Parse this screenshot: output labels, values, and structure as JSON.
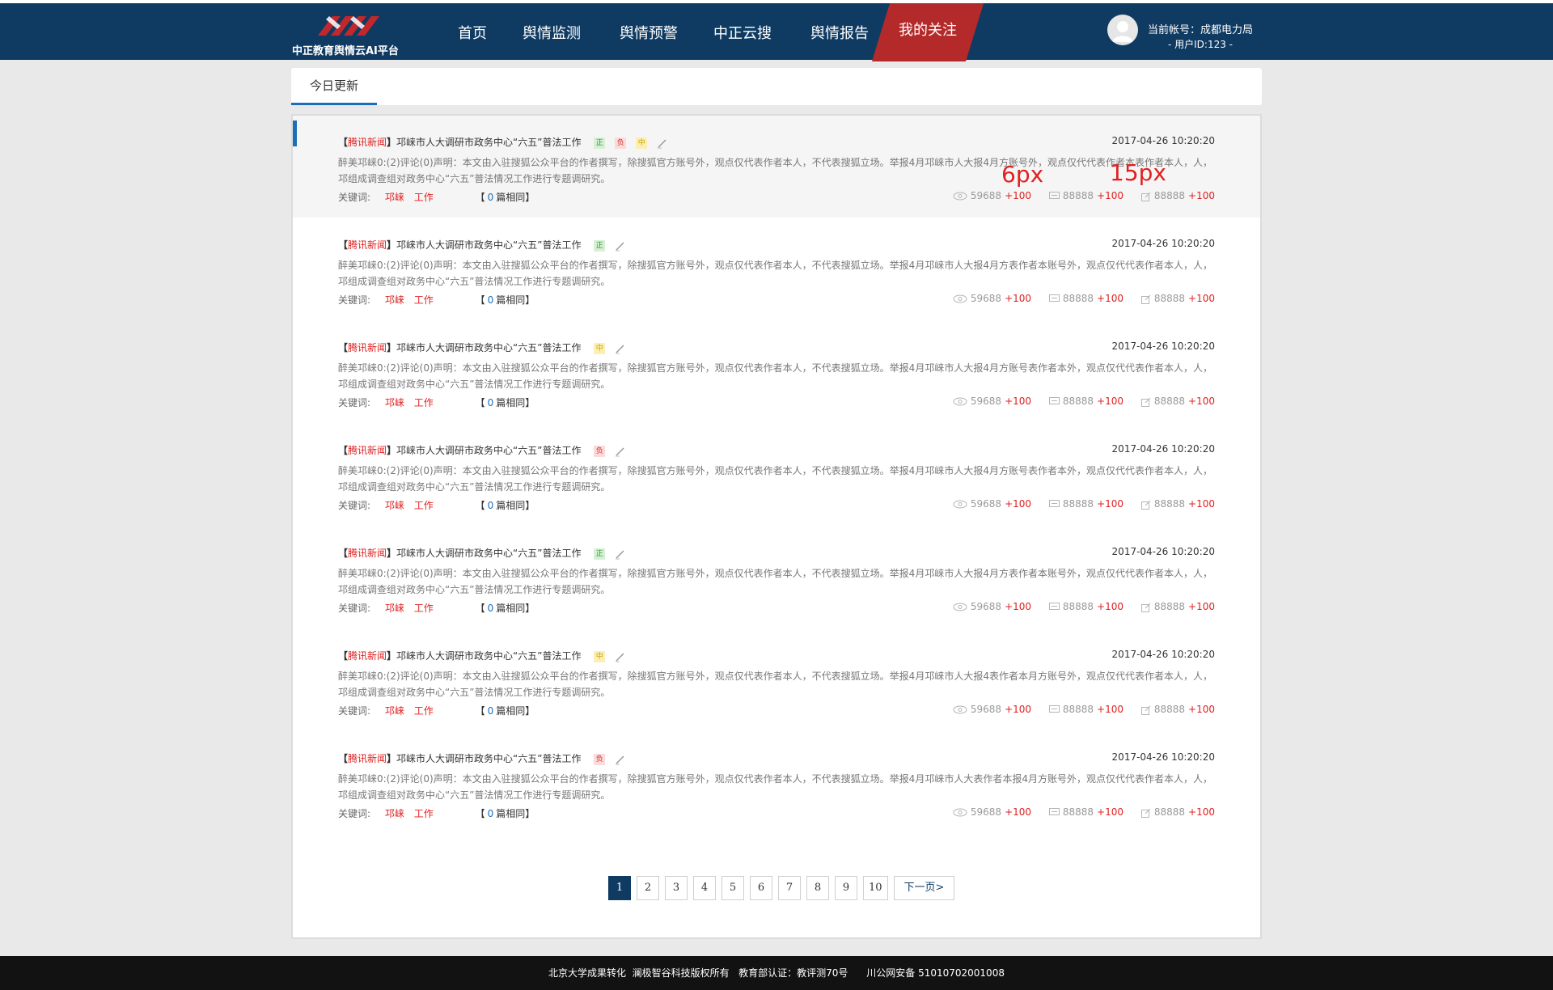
{
  "header": {
    "logo_text": "中正教育舆情云AI平台",
    "nav": [
      "首页",
      "舆情监测",
      "舆情预警",
      "中正云搜",
      "舆情报告"
    ],
    "nav_active": "我的关注",
    "account_label": "当前帐号：成都电力局",
    "user_id": "- 用户ID:123 -"
  },
  "tabs": {
    "active": "今日更新"
  },
  "annotations": {
    "gap_6": "6px",
    "gap_15": "15px"
  },
  "items": [
    {
      "source": "腾讯新闻",
      "title": "邛崃市人大调研市政务中心“六五”普法工作",
      "tags": [
        "正",
        "负",
        "中"
      ],
      "time": "2017-04-26 10:20:20",
      "desc": "醉美邛崃0:(2)评论(0)声明：本文由入驻搜狐公众平台的作者撰写，除搜狐官方账号外，观点仅代表作者本人，不代表搜狐立场。举报4月邛崃市人大报4月方账号外，观点仅代代表作者本表作者本人，人，邛组成调查组对政务中心“六五”普法情况工作进行专题调研究。",
      "kw_label": "关键词:",
      "keywords": [
        "邛崃",
        "工作"
      ],
      "similar_pre": "【",
      "similar_num": "0",
      "similar_post": "篇相同】",
      "views": "59688",
      "views_plus": "+100",
      "comments": "88888",
      "comments_plus": "+100",
      "shares": "88888",
      "shares_plus": "+100"
    },
    {
      "source": "腾讯新闻",
      "title": "邛崃市人大调研市政务中心“六五”普法工作",
      "tags": [
        "正"
      ],
      "time": "2017-04-26 10:20:20",
      "desc": "醉美邛崃0:(2)评论(0)声明：本文由入驻搜狐公众平台的作者撰写，除搜狐官方账号外，观点仅代表作者本人，不代表搜狐立场。举报4月邛崃市人大报4月方表作者本账号外，观点仅代代表作者本人，人，邛组成调查组对政务中心“六五”普法情况工作进行专题调研究。",
      "kw_label": "关键词:",
      "keywords": [
        "邛崃",
        "工作"
      ],
      "similar_pre": "【",
      "similar_num": "0",
      "similar_post": "篇相同】",
      "views": "59688",
      "views_plus": "+100",
      "comments": "88888",
      "comments_plus": "+100",
      "shares": "88888",
      "shares_plus": "+100"
    },
    {
      "source": "腾讯新闻",
      "title": "邛崃市人大调研市政务中心“六五”普法工作",
      "tags": [
        "中"
      ],
      "time": "2017-04-26 10:20:20",
      "desc": "醉美邛崃0:(2)评论(0)声明：本文由入驻搜狐公众平台的作者撰写，除搜狐官方账号外，观点仅代表作者本人，不代表搜狐立场。举报4月邛崃市人大报4月方账号表作者本外，观点仅代代表作者本人，人，邛组成调查组对政务中心“六五”普法情况工作进行专题调研究。",
      "kw_label": "关键词:",
      "keywords": [
        "邛崃",
        "工作"
      ],
      "similar_pre": "【",
      "similar_num": "0",
      "similar_post": "篇相同】",
      "views": "59688",
      "views_plus": "+100",
      "comments": "88888",
      "comments_plus": "+100",
      "shares": "88888",
      "shares_plus": "+100"
    },
    {
      "source": "腾讯新闻",
      "title": "邛崃市人大调研市政务中心“六五”普法工作",
      "tags": [
        "负"
      ],
      "time": "2017-04-26 10:20:20",
      "desc": "醉美邛崃0:(2)评论(0)声明：本文由入驻搜狐公众平台的作者撰写，除搜狐官方账号外，观点仅代表作者本人，不代表搜狐立场。举报4月邛崃市人大报4月方账号表作者本外，观点仅代代表作者本人，人，邛组成调查组对政务中心“六五”普法情况工作进行专题调研究。",
      "kw_label": "关键词:",
      "keywords": [
        "邛崃",
        "工作"
      ],
      "similar_pre": "【",
      "similar_num": "0",
      "similar_post": "篇相同】",
      "views": "59688",
      "views_plus": "+100",
      "comments": "88888",
      "comments_plus": "+100",
      "shares": "88888",
      "shares_plus": "+100"
    },
    {
      "source": "腾讯新闻",
      "title": "邛崃市人大调研市政务中心“六五”普法工作",
      "tags": [
        "正"
      ],
      "time": "2017-04-26 10:20:20",
      "desc": "醉美邛崃0:(2)评论(0)声明：本文由入驻搜狐公众平台的作者撰写，除搜狐官方账号外，观点仅代表作者本人，不代表搜狐立场。举报4月邛崃市人大报4月方表作者本账号外，观点仅代代表作者本人，人，邛组成调查组对政务中心“六五”普法情况工作进行专题调研究。",
      "kw_label": "关键词:",
      "keywords": [
        "邛崃",
        "工作"
      ],
      "similar_pre": "【",
      "similar_num": "0",
      "similar_post": "篇相同】",
      "views": "59688",
      "views_plus": "+100",
      "comments": "88888",
      "comments_plus": "+100",
      "shares": "88888",
      "shares_plus": "+100"
    },
    {
      "source": "腾讯新闻",
      "title": "邛崃市人大调研市政务中心“六五”普法工作",
      "tags": [
        "中"
      ],
      "time": "2017-04-26 10:20:20",
      "desc": "醉美邛崃0:(2)评论(0)声明：本文由入驻搜狐公众平台的作者撰写，除搜狐官方账号外，观点仅代表作者本人，不代表搜狐立场。举报4月邛崃市人大报4表作者本月方账号外，观点仅代代表作者本人，人，邛组成调查组对政务中心“六五”普法情况工作进行专题调研究。",
      "kw_label": "关键词:",
      "keywords": [
        "邛崃",
        "工作"
      ],
      "similar_pre": "【",
      "similar_num": "0",
      "similar_post": "篇相同】",
      "views": "59688",
      "views_plus": "+100",
      "comments": "88888",
      "comments_plus": "+100",
      "shares": "88888",
      "shares_plus": "+100"
    },
    {
      "source": "腾讯新闻",
      "title": "邛崃市人大调研市政务中心“六五”普法工作",
      "tags": [
        "负"
      ],
      "time": "2017-04-26 10:20:20",
      "desc": "醉美邛崃0:(2)评论(0)声明：本文由入驻搜狐公众平台的作者撰写，除搜狐官方账号外，观点仅代表作者本人，不代表搜狐立场。举报4月邛崃市人大表作者本报4月方账号外，观点仅代代表作者本人，人，邛组成调查组对政务中心“六五”普法情况工作进行专题调研究。",
      "kw_label": "关键词:",
      "keywords": [
        "邛崃",
        "工作"
      ],
      "similar_pre": "【",
      "similar_num": "0",
      "similar_post": "篇相同】",
      "views": "59688",
      "views_plus": "+100",
      "comments": "88888",
      "comments_plus": "+100",
      "shares": "88888",
      "shares_plus": "+100"
    }
  ],
  "pagination": {
    "pages": [
      "1",
      "2",
      "3",
      "4",
      "5",
      "6",
      "7",
      "8",
      "9",
      "10"
    ],
    "current": "1",
    "next_label": "下一页>"
  },
  "footer": {
    "text": "北京大学成果转化  澜极智谷科技版权所有   教育部认证：教评测70号      川公网安备 51010702001008"
  }
}
